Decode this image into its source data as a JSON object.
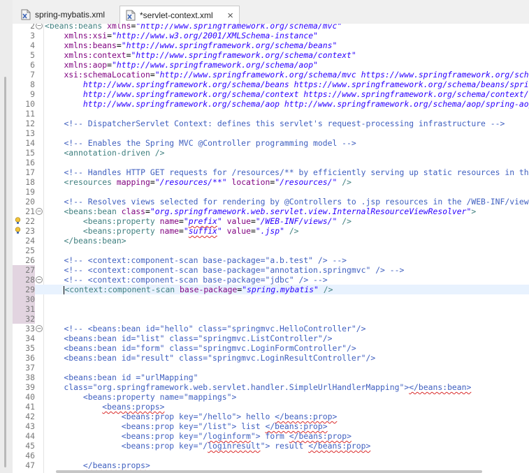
{
  "tabs": [
    {
      "label": "spring-mybatis.xml",
      "active": false
    },
    {
      "label": "*servlet-context.xml",
      "active": true,
      "close": "×"
    }
  ],
  "colors": {
    "tag": "#3f7f7f",
    "attribute": "#7f007f",
    "value": "#2a00ff",
    "comment": "#3f5fbf",
    "current_line": "#e8f2fe"
  },
  "editor": {
    "lines": [
      {
        "n": "2",
        "fold": "−",
        "tokens": [
          [
            "t",
            "<beans:beans "
          ],
          [
            "a",
            "xmlns"
          ],
          [
            "p",
            "="
          ],
          [
            "s",
            "\"http://www.springframework.org/schema/mvc\""
          ]
        ]
      },
      {
        "n": "3",
        "tokens": [
          [
            "p",
            "    "
          ],
          [
            "a",
            "xmlns:xsi"
          ],
          [
            "p",
            "="
          ],
          [
            "s",
            "\"http://www.w3.org/2001/XMLSchema-instance\""
          ]
        ]
      },
      {
        "n": "4",
        "tokens": [
          [
            "p",
            "    "
          ],
          [
            "a",
            "xmlns:beans"
          ],
          [
            "p",
            "="
          ],
          [
            "s",
            "\"http://www.springframework.org/schema/beans\""
          ]
        ]
      },
      {
        "n": "5",
        "tokens": [
          [
            "p",
            "    "
          ],
          [
            "a",
            "xmlns:context"
          ],
          [
            "p",
            "="
          ],
          [
            "s",
            "\"http://www.springframework.org/schema/context\""
          ]
        ]
      },
      {
        "n": "6",
        "tokens": [
          [
            "p",
            "    "
          ],
          [
            "a",
            "xmlns:aop"
          ],
          [
            "p",
            "="
          ],
          [
            "s",
            "\"http://www.springframework.org/schema/aop\""
          ]
        ]
      },
      {
        "n": "7",
        "tokens": [
          [
            "p",
            "    "
          ],
          [
            "a",
            "xsi:schemaLocation"
          ],
          [
            "p",
            "="
          ],
          [
            "s",
            "\"http://www.springframework.org/schema/mvc https://www.springframework.org/schema/mvc/spring-mvc.xsd"
          ]
        ]
      },
      {
        "n": "8",
        "tokens": [
          [
            "s",
            "        http://www.springframework.org/schema/beans https://www.springframework.org/schema/beans/spring-beans.xsd"
          ]
        ]
      },
      {
        "n": "9",
        "tokens": [
          [
            "s",
            "        http://www.springframework.org/schema/context https://www.springframework.org/schema/context/spring-context.xsd"
          ]
        ]
      },
      {
        "n": "10",
        "tokens": [
          [
            "s",
            "        http://www.springframework.org/schema/aop http://www.springframework.org/schema/aop/spring-aop.xsd\">"
          ]
        ]
      },
      {
        "n": "11",
        "tokens": []
      },
      {
        "n": "12",
        "tokens": [
          [
            "p",
            "    "
          ],
          [
            "c",
            "<!-- DispatcherServlet Context: defines this servlet's request-processing infrastructure -->"
          ]
        ]
      },
      {
        "n": "13",
        "tokens": []
      },
      {
        "n": "14",
        "tokens": [
          [
            "p",
            "    "
          ],
          [
            "c",
            "<!-- Enables the Spring MVC @Controller programming model -->"
          ]
        ]
      },
      {
        "n": "15",
        "tokens": [
          [
            "p",
            "    "
          ],
          [
            "t",
            "<annotation-driven />"
          ]
        ]
      },
      {
        "n": "16",
        "tokens": []
      },
      {
        "n": "17",
        "tokens": [
          [
            "p",
            "    "
          ],
          [
            "c",
            "<!-- Handles HTTP GET requests for /resources/** by efficiently serving up static resources in the ${webappRoot}/resources directory -->"
          ]
        ]
      },
      {
        "n": "18",
        "tokens": [
          [
            "p",
            "    "
          ],
          [
            "t",
            "<resources "
          ],
          [
            "a",
            "mapping"
          ],
          [
            "p",
            "="
          ],
          [
            "s",
            "\"/resources/**\""
          ],
          [
            "p",
            " "
          ],
          [
            "a",
            "location"
          ],
          [
            "p",
            "="
          ],
          [
            "s",
            "\"/resources/\""
          ],
          [
            "p",
            " "
          ],
          [
            "t",
            "/>"
          ]
        ]
      },
      {
        "n": "19",
        "tokens": []
      },
      {
        "n": "20",
        "tokens": [
          [
            "p",
            "    "
          ],
          [
            "c",
            "<!-- Resolves views selected for rendering by @Controllers to .jsp resources in the /WEB-INF/views directory -->"
          ]
        ]
      },
      {
        "n": "21",
        "fold": "−",
        "tokens": [
          [
            "p",
            "    "
          ],
          [
            "t",
            "<beans:bean "
          ],
          [
            "a",
            "class"
          ],
          [
            "p",
            "="
          ],
          [
            "s",
            "\"org.springframework.web.servlet.view.InternalResourceViewResolver\""
          ],
          [
            "t",
            ">"
          ]
        ]
      },
      {
        "n": "22",
        "warn": true,
        "tokens": [
          [
            "p",
            "        "
          ],
          [
            "t",
            "<beans:property "
          ],
          [
            "a",
            "name"
          ],
          [
            "p",
            "="
          ],
          [
            "s",
            "\""
          ],
          [
            "su",
            "prefix"
          ],
          [
            "s",
            "\""
          ],
          [
            "p",
            " "
          ],
          [
            "a",
            "value"
          ],
          [
            "p",
            "="
          ],
          [
            "s",
            "\"/WEB-INF/views/\""
          ],
          [
            "p",
            " "
          ],
          [
            "t",
            "/>"
          ]
        ]
      },
      {
        "n": "23",
        "warn": true,
        "tokens": [
          [
            "p",
            "        "
          ],
          [
            "t",
            "<beans:property "
          ],
          [
            "a",
            "name"
          ],
          [
            "p",
            "="
          ],
          [
            "s",
            "\""
          ],
          [
            "su",
            "suffix"
          ],
          [
            "s",
            "\""
          ],
          [
            "p",
            " "
          ],
          [
            "a",
            "value"
          ],
          [
            "p",
            "="
          ],
          [
            "s",
            "\".jsp\""
          ],
          [
            "p",
            " "
          ],
          [
            "t",
            "/>"
          ]
        ]
      },
      {
        "n": "24",
        "tokens": [
          [
            "p",
            "    "
          ],
          [
            "t",
            "</beans:bean>"
          ]
        ]
      },
      {
        "n": "25",
        "tokens": []
      },
      {
        "n": "26",
        "tokens": [
          [
            "p",
            "    "
          ],
          [
            "c",
            "<!-- <context:component-scan base-package=\"a.b.test\" /> -->"
          ]
        ]
      },
      {
        "n": "27",
        "changed": true,
        "tokens": [
          [
            "p",
            "    "
          ],
          [
            "c",
            "<!-- <context:component-scan base-package=\"annotation.springmvc\" /> -->"
          ]
        ]
      },
      {
        "n": "28",
        "changed": true,
        "fold": "−",
        "tokens": [
          [
            "p",
            "    "
          ],
          [
            "c",
            "<!-- <context:component-scan base-package=\""
          ],
          [
            "cu",
            "jdbc"
          ],
          [
            "c",
            "\" /> -->"
          ]
        ]
      },
      {
        "n": "29",
        "changed": true,
        "current": true,
        "tokens": [
          [
            "p",
            "    "
          ],
          [
            "caret",
            ""
          ],
          [
            "t",
            "<context:component-scan "
          ],
          [
            "a",
            "base-package"
          ],
          [
            "p",
            "="
          ],
          [
            "s",
            "\"spring.mybatis\""
          ],
          [
            "p",
            " "
          ],
          [
            "t",
            "/>"
          ]
        ]
      },
      {
        "n": "30",
        "changed": true,
        "tokens": []
      },
      {
        "n": "31",
        "changed": true,
        "tokens": []
      },
      {
        "n": "32",
        "changed": true,
        "tokens": []
      },
      {
        "n": "33",
        "fold": "−",
        "tokens": [
          [
            "p",
            "    "
          ],
          [
            "c",
            "<!-- <beans:bean id=\"hello\" class=\"springmvc.HelloController\"/>"
          ]
        ]
      },
      {
        "n": "34",
        "tokens": [
          [
            "c",
            "    <beans:bean id=\"list\" class=\"springmvc.ListController\"/>"
          ]
        ]
      },
      {
        "n": "35",
        "tokens": [
          [
            "c",
            "    <beans:bean id=\"form\" class=\"springmvc.LoginFormController\"/>"
          ]
        ]
      },
      {
        "n": "36",
        "tokens": [
          [
            "c",
            "    <beans:bean id=\"result\" class=\"springmvc.LoginResultController\"/>"
          ]
        ]
      },
      {
        "n": "37",
        "tokens": []
      },
      {
        "n": "38",
        "tokens": [
          [
            "c",
            "    <beans:bean id =\"urlMapping\""
          ]
        ]
      },
      {
        "n": "39",
        "tokens": [
          [
            "c",
            "    class=\"org.springframework.web.servlet.handler.SimpleUrlHandlerMapping\">"
          ],
          [
            "cu",
            "</beans:bean>"
          ]
        ]
      },
      {
        "n": "40",
        "tokens": [
          [
            "c",
            "        <beans:property name=\"mappings\">"
          ]
        ]
      },
      {
        "n": "41",
        "tokens": [
          [
            "c",
            "            "
          ],
          [
            "cu",
            "<beans:props>"
          ]
        ]
      },
      {
        "n": "42",
        "tokens": [
          [
            "c",
            "                <beans:prop key=\"/hello\"> hello "
          ],
          [
            "cu",
            "</beans:prop>"
          ]
        ]
      },
      {
        "n": "43",
        "tokens": [
          [
            "c",
            "                <beans:prop key=\"/list\"> list "
          ],
          [
            "cu",
            "</beans:prop>"
          ]
        ]
      },
      {
        "n": "44",
        "tokens": [
          [
            "c",
            "                <beans:prop key=\"/"
          ],
          [
            "cu",
            "loginform"
          ],
          [
            "c",
            "\"> form "
          ],
          [
            "cu",
            "</beans:prop>"
          ]
        ]
      },
      {
        "n": "45",
        "tokens": [
          [
            "c",
            "                <beans:prop key=\"/"
          ],
          [
            "cu",
            "loginresult"
          ],
          [
            "c",
            "\"> result "
          ],
          [
            "cu",
            "</beans:prop>"
          ]
        ]
      },
      {
        "n": "46",
        "tokens": []
      },
      {
        "n": "47",
        "tokens": [
          [
            "c",
            "        "
          ],
          [
            "cu",
            "</beans:props>"
          ]
        ]
      }
    ]
  }
}
